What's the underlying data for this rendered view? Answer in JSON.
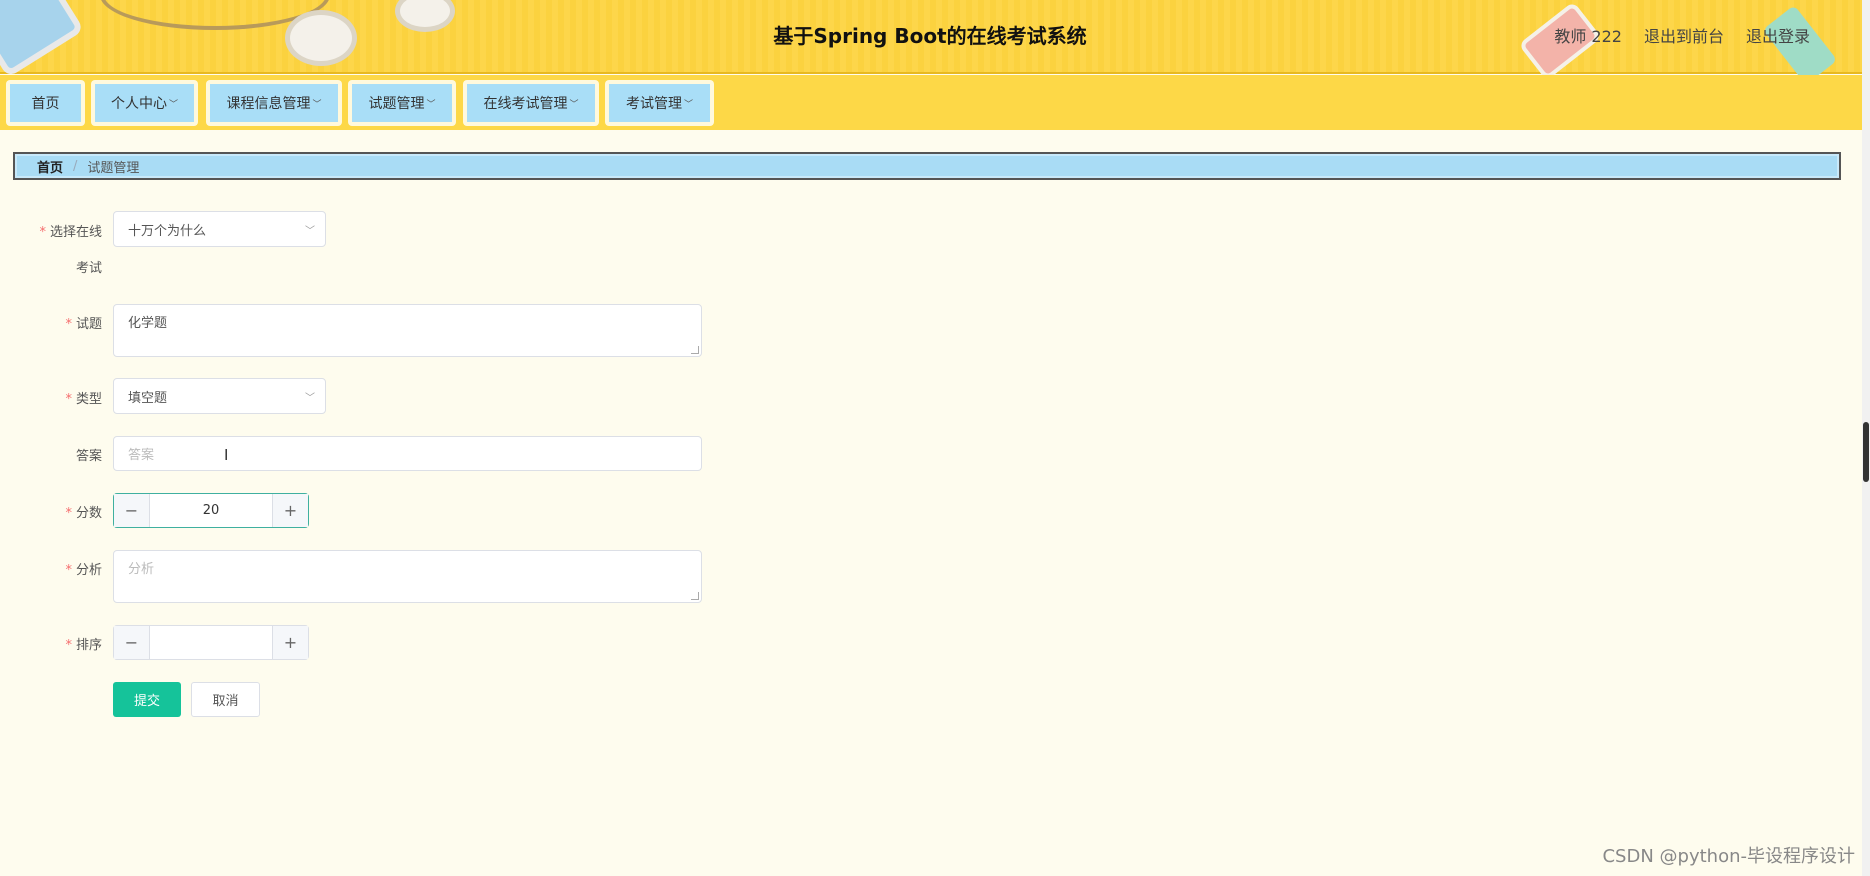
{
  "header": {
    "title": "基于Spring Boot的在线考试系统",
    "user": "教师 222",
    "links": [
      "退出到前台",
      "退出登录"
    ]
  },
  "nav": [
    {
      "label": "首页",
      "has_dropdown": false
    },
    {
      "label": "个人中心",
      "has_dropdown": true
    },
    {
      "label": "课程信息管理",
      "has_dropdown": true
    },
    {
      "label": "试题管理",
      "has_dropdown": true
    },
    {
      "label": "在线考试管理",
      "has_dropdown": true
    },
    {
      "label": "考试管理",
      "has_dropdown": true
    }
  ],
  "breadcrumb": {
    "home": "首页",
    "separator": "/",
    "current": "试题管理"
  },
  "form": {
    "exam": {
      "label_line1": "选择在线",
      "label_line2": "考试",
      "value": "十万个为什么"
    },
    "question": {
      "label": "试题",
      "value": "化学题"
    },
    "type": {
      "label": "类型",
      "value": "填空题"
    },
    "answer": {
      "label": "答案",
      "placeholder": "答案"
    },
    "score": {
      "label": "分数",
      "value": "20"
    },
    "analysis": {
      "label": "分析",
      "placeholder": "分析"
    },
    "order": {
      "label": "排序",
      "value": ""
    },
    "submit_label": "提交",
    "cancel_label": "取消"
  },
  "watermark": "CSDN @python-毕设程序设计",
  "icons": {
    "minus": "−",
    "plus": "+",
    "chevron": "⌄"
  },
  "colors": {
    "header_bg": "#fdd64a",
    "nav_item_bg": "#a9def7",
    "primary": "#15c39a",
    "required": "#f56c6c"
  }
}
